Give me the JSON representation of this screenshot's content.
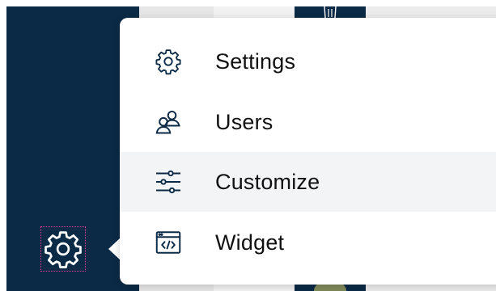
{
  "menu": {
    "items": [
      {
        "label": "Settings",
        "icon": "gear-icon"
      },
      {
        "label": "Users",
        "icon": "users-icon"
      },
      {
        "label": "Customize",
        "icon": "sliders-icon",
        "highlighted": true
      },
      {
        "label": "Widget",
        "icon": "code-window-icon"
      }
    ]
  },
  "sidebar": {
    "active_icon": "gear-icon"
  },
  "colors": {
    "sidebar_bg": "#0b2a46",
    "highlight_bg": "#f3f4f6",
    "icon_stroke": "#0b2a46",
    "focus_outline": "#e0399a"
  }
}
